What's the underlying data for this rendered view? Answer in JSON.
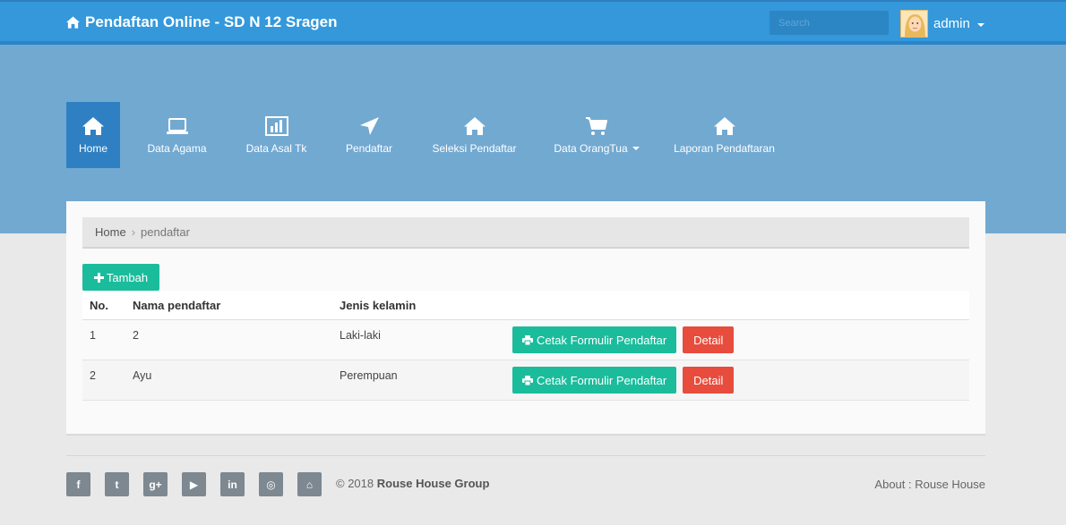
{
  "header": {
    "brand": "Pendaftan Online - SD N 12 Sragen",
    "search_placeholder": "Search",
    "user": "admin"
  },
  "nav": [
    {
      "label": "Home",
      "icon": "home-icon",
      "active": true
    },
    {
      "label": "Data Agama",
      "icon": "laptop-icon"
    },
    {
      "label": "Data Asal Tk",
      "icon": "bar-chart-icon"
    },
    {
      "label": "Pendaftar",
      "icon": "location-arrow-icon"
    },
    {
      "label": "Seleksi Pendaftar",
      "icon": "home-icon"
    },
    {
      "label": "Data OrangTua",
      "icon": "shopping-cart-icon",
      "dropdown": true
    },
    {
      "label": "Laporan Pendaftaran",
      "icon": "home-icon"
    }
  ],
  "breadcrumb": {
    "home": "Home",
    "current": "pendaftar"
  },
  "tambah_label": "Tambah",
  "table": {
    "headers": [
      "No.",
      "Nama pendaftar",
      "Jenis kelamin"
    ],
    "rows": [
      {
        "no": "1",
        "nama": "2",
        "jk": "Laki-laki"
      },
      {
        "no": "2",
        "nama": "Ayu",
        "jk": "Perempuan"
      }
    ],
    "cetak_label": "Cetak Formulir Pendaftar",
    "detail_label": "Detail"
  },
  "footer": {
    "socials": [
      "facebook-icon",
      "twitter-icon",
      "google-plus-icon",
      "youtube-icon",
      "linkedin-icon",
      "instagram-icon",
      "github-icon"
    ],
    "social_glyphs": [
      "f",
      "t",
      "g+",
      "▶",
      "in",
      "◎",
      "⌂"
    ],
    "copyright_prefix": "© 2018",
    "copyright_org": "Rouse House Group",
    "about": "About : Rouse House"
  },
  "colors": {
    "primary": "#3498db",
    "hero": "#72a9d1",
    "success": "#1abc9c",
    "danger": "#e74c3c"
  }
}
